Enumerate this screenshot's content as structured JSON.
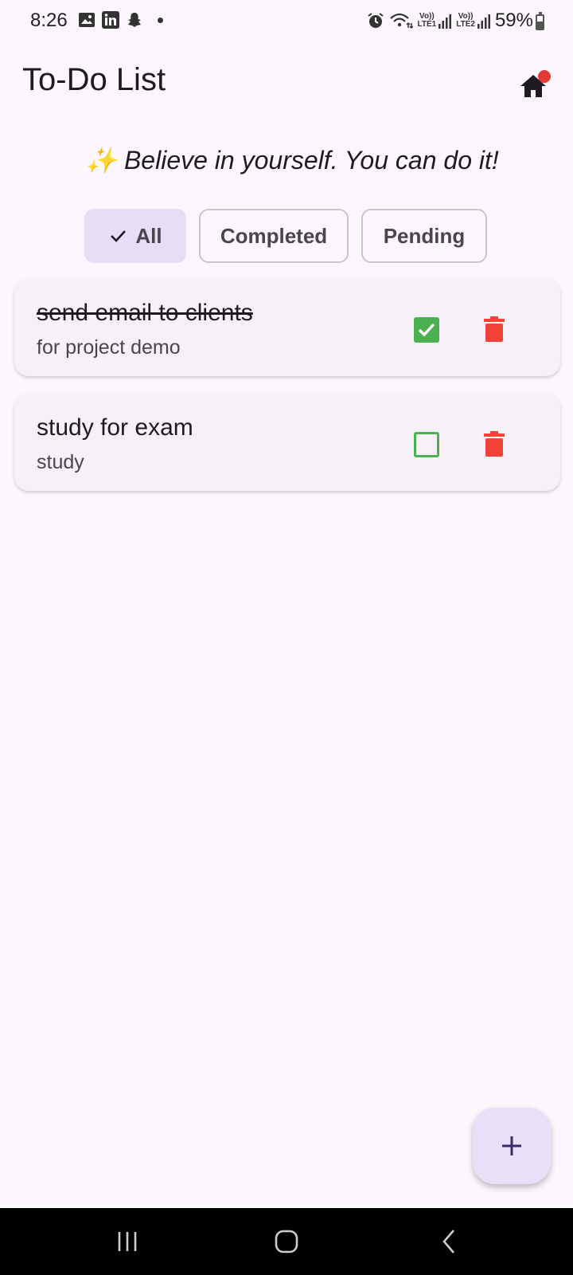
{
  "status_bar": {
    "time": "8:26",
    "left_icons": [
      "gallery-icon",
      "linkedin-icon",
      "snapchat-icon"
    ],
    "right_icons": [
      "alarm-icon",
      "wifi-icon",
      "signal-lte1-icon",
      "signal-lte2-icon"
    ],
    "lte1_label_top": "Vo))",
    "lte1_label_bottom": "LTE1",
    "lte2_label_top": "Vo))",
    "lte2_label_bottom": "LTE2",
    "battery_percent": "59%",
    "battery_level": 0.59
  },
  "app_bar": {
    "title": "To-Do List",
    "home_icon": "home-icon"
  },
  "quote": "✨ Believe in yourself. You can do it!",
  "filters": {
    "selected": "All",
    "all_label": "All",
    "completed_label": "Completed",
    "pending_label": "Pending"
  },
  "tasks": [
    {
      "title": "send email to clients",
      "subtitle": "for project demo",
      "completed": true
    },
    {
      "title": "study for exam",
      "subtitle": "study",
      "completed": false
    }
  ],
  "colors": {
    "background": "#fcf7fd",
    "accent": "#e7ddf6",
    "check_green": "#4caf50",
    "delete_red": "#f44336",
    "notification_red": "#e53935"
  },
  "fab": {
    "icon": "plus-icon"
  },
  "nav_bar": {
    "icons": [
      "recent-apps-icon",
      "home-nav-icon",
      "back-icon"
    ]
  }
}
